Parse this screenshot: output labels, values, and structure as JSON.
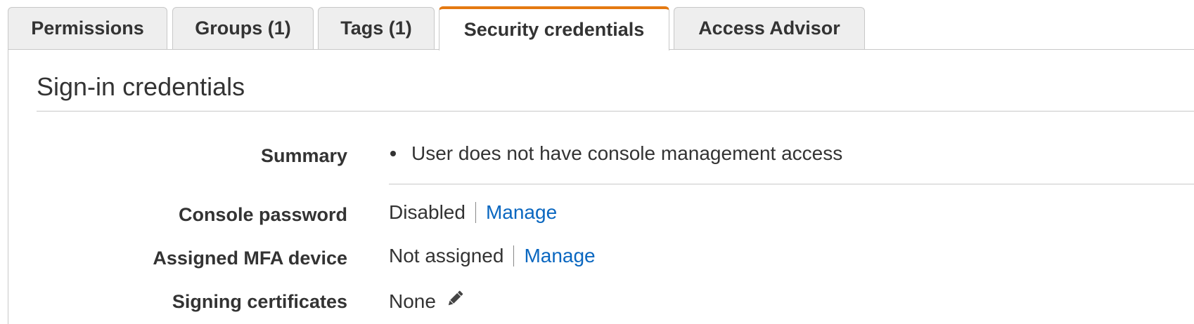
{
  "tabs": [
    {
      "label": "Permissions",
      "active": false
    },
    {
      "label": "Groups (1)",
      "active": false
    },
    {
      "label": "Tags (1)",
      "active": false
    },
    {
      "label": "Security credentials",
      "active": true
    },
    {
      "label": "Access Advisor",
      "active": false
    }
  ],
  "section": {
    "title": "Sign-in credentials"
  },
  "rows": {
    "summary": {
      "label": "Summary",
      "items": [
        "User does not have console management access"
      ]
    },
    "console_password": {
      "label": "Console password",
      "value": "Disabled",
      "action": "Manage"
    },
    "mfa_device": {
      "label": "Assigned MFA device",
      "value": "Not assigned",
      "action": "Manage"
    },
    "signing_certificates": {
      "label": "Signing certificates",
      "value": "None",
      "edit_icon": "pencil-icon"
    }
  },
  "colors": {
    "active_tab_accent": "#e47911",
    "link": "#0a67c0",
    "text": "#333333",
    "tab_bg": "#eeeeee",
    "border": "#c8c8c8"
  }
}
